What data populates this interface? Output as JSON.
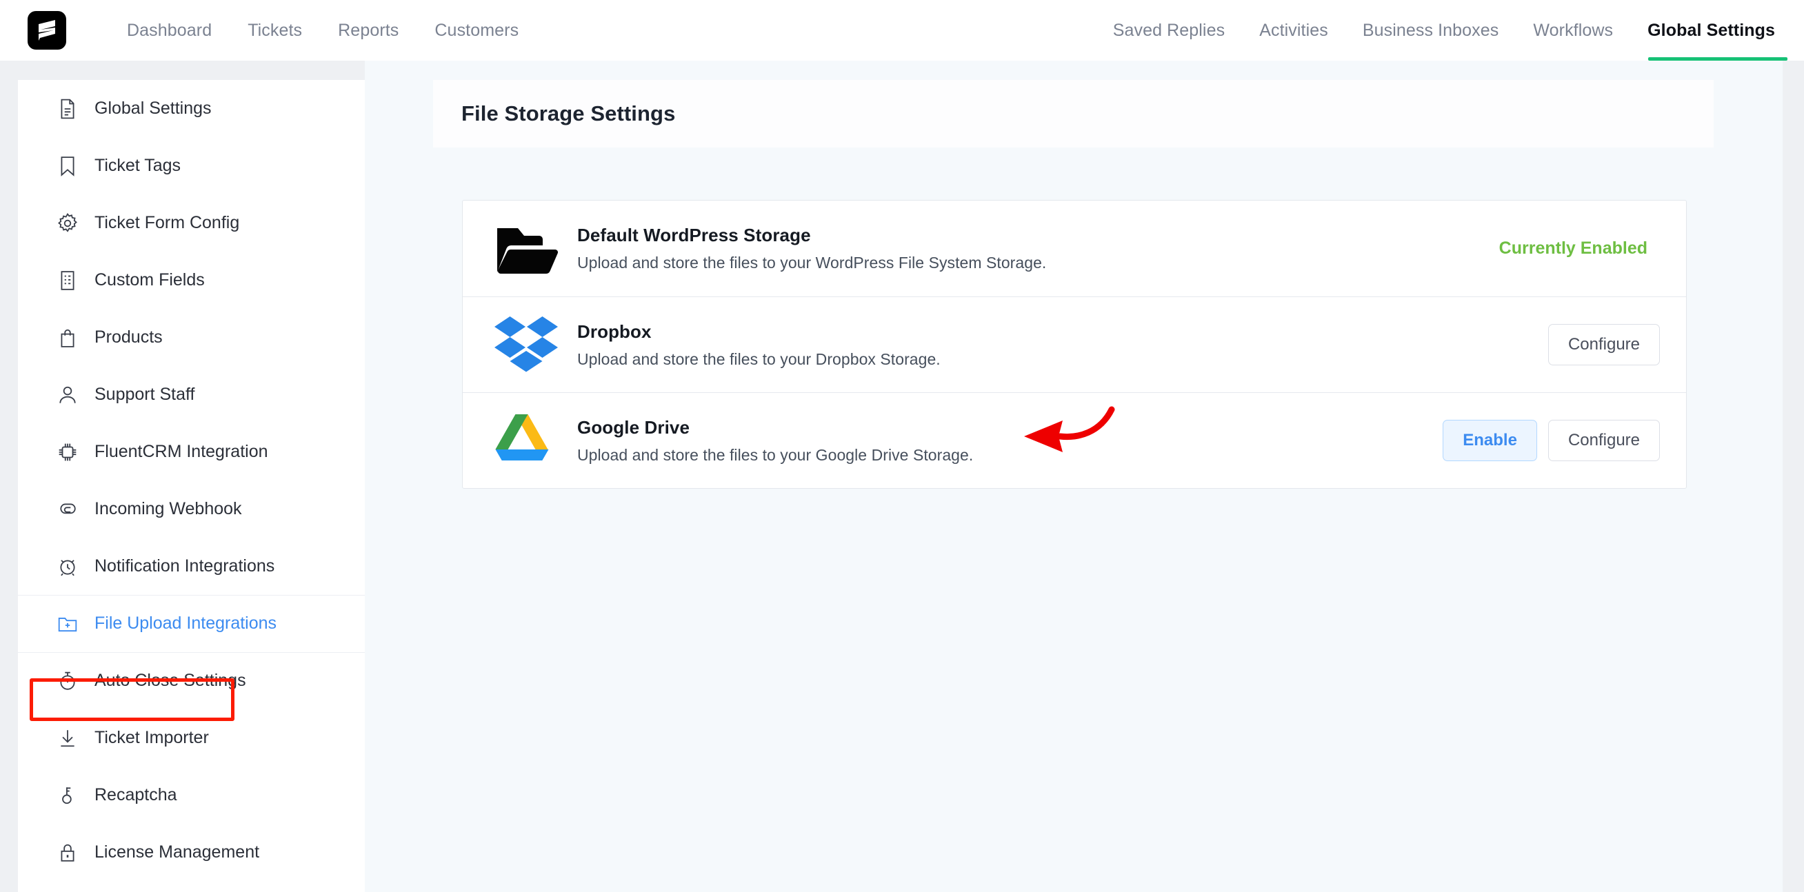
{
  "app": {
    "logo_icon": "fluent-support-logo-icon"
  },
  "header": {
    "nav_left": [
      {
        "label": "Dashboard",
        "active": false
      },
      {
        "label": "Tickets",
        "active": false
      },
      {
        "label": "Reports",
        "active": false
      },
      {
        "label": "Customers",
        "active": false
      }
    ],
    "nav_right": [
      {
        "label": "Saved Replies",
        "active": false
      },
      {
        "label": "Activities",
        "active": false
      },
      {
        "label": "Business Inboxes",
        "active": false
      },
      {
        "label": "Workflows",
        "active": false
      },
      {
        "label": "Global Settings",
        "active": true
      }
    ],
    "active_underline_color": "#16c176"
  },
  "sidebar": {
    "items": [
      {
        "label": "Global Settings",
        "icon": "document-icon",
        "active": false
      },
      {
        "label": "Ticket Tags",
        "icon": "bookmark-icon",
        "active": false
      },
      {
        "label": "Ticket Form Config",
        "icon": "gear-icon",
        "active": false
      },
      {
        "label": "Custom Fields",
        "icon": "list-document-icon",
        "active": false
      },
      {
        "label": "Products",
        "icon": "shopping-bag-icon",
        "active": false
      },
      {
        "label": "Support Staff",
        "icon": "user-icon",
        "active": false
      },
      {
        "label": "FluentCRM Integration",
        "icon": "chip-icon",
        "active": false
      },
      {
        "label": "Incoming Webhook",
        "icon": "webhook-icon",
        "active": false
      },
      {
        "label": "Notification Integrations",
        "icon": "alarm-clock-icon",
        "active": false
      },
      {
        "label": "File Upload Integrations",
        "icon": "folder-plus-icon",
        "active": true
      },
      {
        "label": "Auto Close Settings",
        "icon": "timer-icon",
        "active": false
      },
      {
        "label": "Ticket Importer",
        "icon": "download-icon",
        "active": false
      },
      {
        "label": "Recaptcha",
        "icon": "key-icon",
        "active": false
      },
      {
        "label": "License Management",
        "icon": "lock-icon",
        "active": false
      }
    ],
    "active_color": "#3c8bf0"
  },
  "main": {
    "title": "File Storage Settings",
    "storages": [
      {
        "name": "Default WordPress Storage",
        "description": "Upload and store the files to your WordPress File System Storage.",
        "icon": "folder-open-black-icon",
        "status_label": "Currently Enabled",
        "status_color": "#6ebe42",
        "enable_label": null,
        "configure_label": null
      },
      {
        "name": "Dropbox",
        "description": "Upload and store the files to your Dropbox Storage.",
        "icon": "dropbox-logo-icon",
        "status_label": null,
        "enable_label": null,
        "configure_label": "Configure"
      },
      {
        "name": "Google Drive",
        "description": "Upload and store the files to your Google Drive Storage.",
        "icon": "google-drive-logo-icon",
        "status_label": null,
        "enable_label": "Enable",
        "configure_label": "Configure"
      }
    ]
  },
  "annotations": {
    "box_color": "#fc1c04",
    "arrow_color": "#ee0000",
    "box_target": "File Upload Integrations",
    "arrow_target": "Google Drive"
  }
}
